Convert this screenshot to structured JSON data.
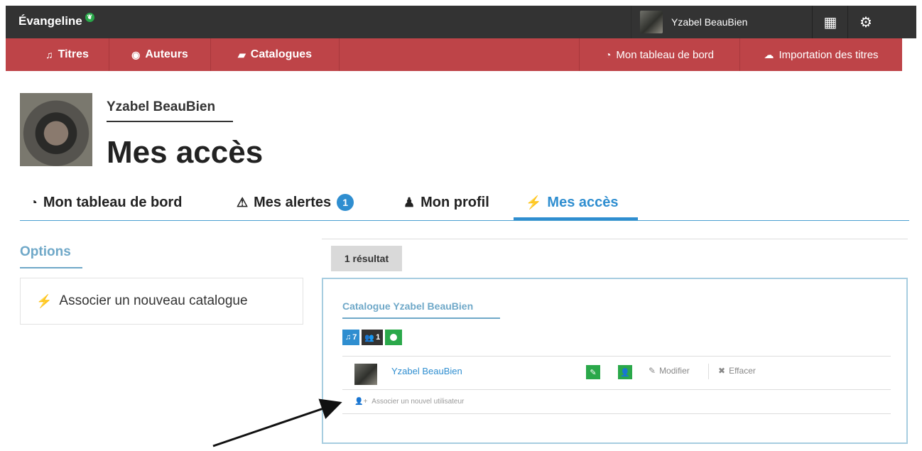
{
  "topbar": {
    "brand": "Évangeline",
    "user_name": "Yzabel BeauBien"
  },
  "nav": {
    "left": [
      {
        "label": "Titres",
        "icon": "music-icon"
      },
      {
        "label": "Auteurs",
        "icon": "user-circle-icon"
      },
      {
        "label": "Catalogues",
        "icon": "book-icon"
      }
    ],
    "right": [
      {
        "label": "Mon tableau de bord",
        "icon": "dashboard-icon"
      },
      {
        "label": "Importation des titres",
        "icon": "cloud-upload-icon"
      }
    ]
  },
  "header": {
    "user_name": "Yzabel BeauBien",
    "title": "Mes accès"
  },
  "tabs": {
    "dashboard": "Mon tableau de bord",
    "alerts": "Mes alertes",
    "alerts_count": "1",
    "profile": "Mon profil",
    "access": "Mes accès"
  },
  "options": {
    "title": "Options",
    "associate_catalog": "Associer un nouveau catalogue"
  },
  "results": {
    "count_label": "1 résultat",
    "catalog_title": "Catalogue Yzabel BeauBien",
    "badges": {
      "titles_count": "7",
      "authors_count": "1"
    },
    "user_row": {
      "name": "Yzabel BeauBien",
      "edit_label": "Modifier",
      "delete_label": "Effacer"
    },
    "associate_user": "Associer un nouvel utilisateur"
  },
  "colors": {
    "topbar": "#333333",
    "nav": "#be4448",
    "accent": "#2f8ed0",
    "green": "#2aa84a",
    "muted_blue": "#6fa8c8"
  }
}
